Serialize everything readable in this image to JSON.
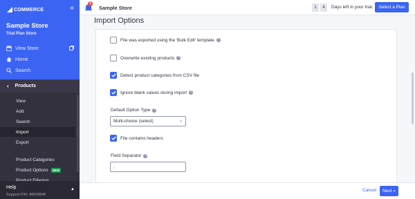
{
  "sidebar": {
    "logo_text": "COMMERCE",
    "collapse_glyph": "«",
    "store_name": "Sample Store",
    "plan_label": "Trial Plan Store",
    "links": {
      "view_store": "View Store",
      "home": "Home",
      "search": "Search"
    },
    "section": "Products",
    "items": [
      {
        "label": "View"
      },
      {
        "label": "Add"
      },
      {
        "label": "Search"
      },
      {
        "label": "Import"
      },
      {
        "label": "Export"
      },
      {
        "label": "Product Categories"
      },
      {
        "label": "Product Options"
      },
      {
        "label": "Product Filtering"
      }
    ],
    "new_badge": "NEW",
    "help": {
      "title": "Help",
      "support_pin": "Support PIN: 48609846"
    }
  },
  "topbar": {
    "notification_count": "1",
    "store_title": "Sample Store",
    "days": [
      "1",
      "4"
    ],
    "trial_text": "Days left in your trial.",
    "select_plan": "Select a Plan"
  },
  "main": {
    "title": "Import Options",
    "options": [
      {
        "label": "File was exported using the 'Bulk Edit' template",
        "checked": false,
        "help": true
      },
      {
        "label": "Overwrite existing products",
        "checked": false,
        "help": true
      },
      {
        "label": "Detect product categories from CSV file",
        "checked": true,
        "help": false
      },
      {
        "label": "Ignore blank values during import",
        "checked": true,
        "help": true
      }
    ],
    "option_type_label": "Default Option Type",
    "option_type_value": "Multi-choice (select)",
    "contains_headers_label": "File contains headers",
    "contains_headers_checked": true,
    "separator_label": "Field Separator",
    "separator_value": ","
  },
  "footer": {
    "cancel": "Cancel",
    "next": "Next »"
  },
  "colors": {
    "accent": "#3c64f4",
    "sidebar_bg": "#34313f",
    "new_badge": "#1a9e4e",
    "notification": "#e84a43"
  }
}
